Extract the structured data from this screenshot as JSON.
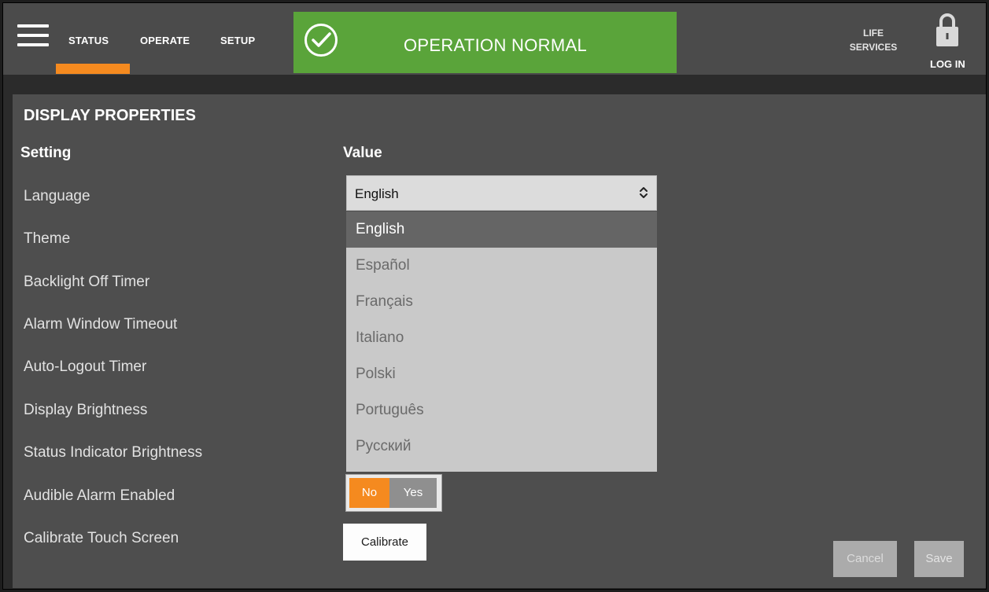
{
  "nav": {
    "tabs": [
      {
        "label": "STATUS",
        "active": true
      },
      {
        "label": "OPERATE",
        "active": false
      },
      {
        "label": "SETUP",
        "active": false
      }
    ],
    "accent_color": "#f58a1f"
  },
  "status": {
    "text": "OPERATION NORMAL",
    "color": "#5aa43a",
    "icon": "check-circle-icon"
  },
  "header_right": {
    "life_services": [
      "LIFE",
      "SERVICES"
    ],
    "login_label": "LOG IN",
    "icon": "lock-icon"
  },
  "panel": {
    "title": "DISPLAY PROPERTIES",
    "col_setting": "Setting",
    "col_value": "Value",
    "settings": [
      "Language",
      "Theme",
      "Backlight Off Timer",
      "Alarm Window Timeout",
      "Auto-Logout Timer",
      "Display Brightness",
      "Status Indicator Brightness",
      "Audible Alarm Enabled",
      "Calibrate Touch Screen"
    ]
  },
  "language_select": {
    "value": "English",
    "options": [
      "English",
      "Español",
      "Français",
      "Italiano",
      "Polski",
      "Português",
      "Русский"
    ]
  },
  "audible_toggle": {
    "no": "No",
    "yes": "Yes",
    "selected": "No"
  },
  "buttons": {
    "calibrate": "Calibrate",
    "cancel": "Cancel",
    "save": "Save"
  }
}
